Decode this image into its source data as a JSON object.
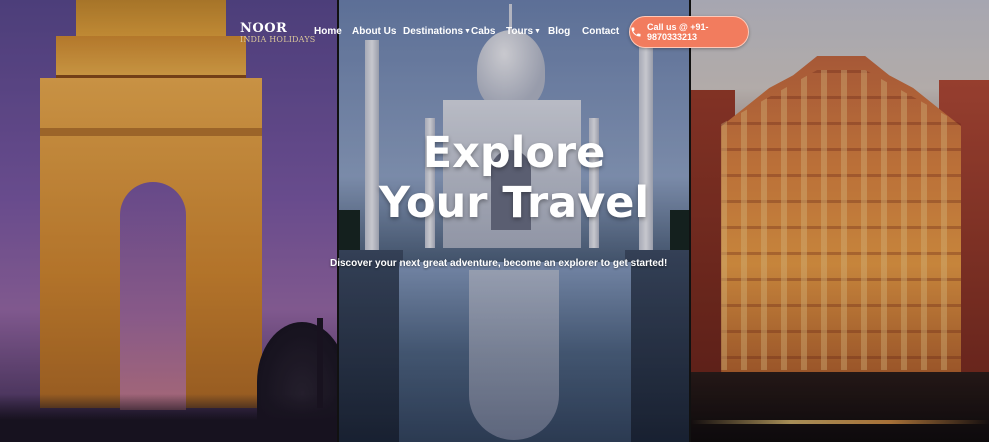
{
  "brand": {
    "name": "NOOR",
    "tagline": "INDIA HOLIDAYS"
  },
  "nav": {
    "items": [
      {
        "label": "Home"
      },
      {
        "label": "About Us"
      },
      {
        "label": "Destinations",
        "has_dropdown": true
      },
      {
        "label": "Cabs"
      },
      {
        "label": "Tours",
        "has_dropdown": true
      },
      {
        "label": "Blog"
      },
      {
        "label": "Contact"
      }
    ],
    "call_button": {
      "label": "Call us @ +91-9870333213",
      "icon": "phone-icon",
      "color": "#f27c5e"
    }
  },
  "hero": {
    "title_line1": "Explore",
    "title_line2": "Your Travel",
    "subtitle": "Discover your next great adventure, become an explorer to get started!"
  },
  "panels": [
    {
      "subject": "india-gate-photo"
    },
    {
      "subject": "taj-mahal-photo"
    },
    {
      "subject": "hawa-mahal-photo"
    }
  ]
}
